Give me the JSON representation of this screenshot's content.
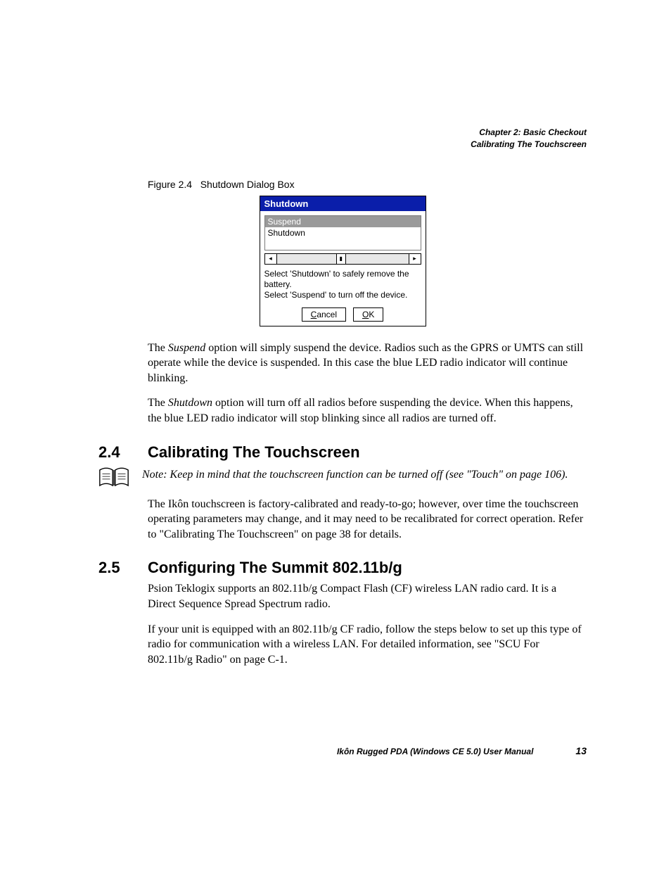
{
  "header": {
    "chapter": "Chapter 2: Basic Checkout",
    "section": "Calibrating The Touchscreen"
  },
  "figure": {
    "label": "Figure 2.4",
    "caption": "Shutdown Dialog Box"
  },
  "dialog": {
    "title": "Shutdown",
    "options": {
      "suspend": "Suspend",
      "shutdown": "Shutdown"
    },
    "help1": "Select 'Shutdown' to safely remove the battery.",
    "help2": "Select 'Suspend' to turn off the device.",
    "cancel_prefix": "C",
    "cancel_rest": "ancel",
    "ok_prefix": "O",
    "ok_rest": "K"
  },
  "para1_a": "The ",
  "para1_b": "Suspend",
  "para1_c": " option will simply suspend the device. Radios such as the GPRS or UMTS can still operate while the device is suspended. In this case the blue LED radio indicator will continue blinking.",
  "para2_a": "The ",
  "para2_b": "Shutdown",
  "para2_c": " option will turn off all radios before suspending the device. When this happens, the blue LED radio indicator will stop blinking since all radios are turned off.",
  "sect24": {
    "num": "2.4",
    "title": "Calibrating The Touchscreen"
  },
  "note": "Note: Keep in mind that the touchscreen function can be turned off (see \"Touch\" on page 106).",
  "para3": "The Ikôn touchscreen is factory-calibrated and ready-to-go; however, over time the touchscreen operating parameters may change, and it may need to be recalibrated for correct operation. Refer to \"Calibrating The Touchscreen\" on page 38 for details.",
  "sect25": {
    "num": "2.5",
    "title": "Configuring The Summit 802.11b/g"
  },
  "para4": "Psion Teklogix supports an 802.11b/g Compact Flash (CF) wireless LAN radio card. It is a Direct Sequence Spread Spectrum radio.",
  "para5": "If your unit is equipped with an 802.11b/g CF radio, follow the steps below to set up this type of radio for communication with a wireless LAN. For detailed information, see \"SCU For 802.11b/g Radio\" on page C-1.",
  "footer": {
    "title": "Ikôn Rugged PDA (Windows CE 5.0) User Manual",
    "page": "13"
  }
}
